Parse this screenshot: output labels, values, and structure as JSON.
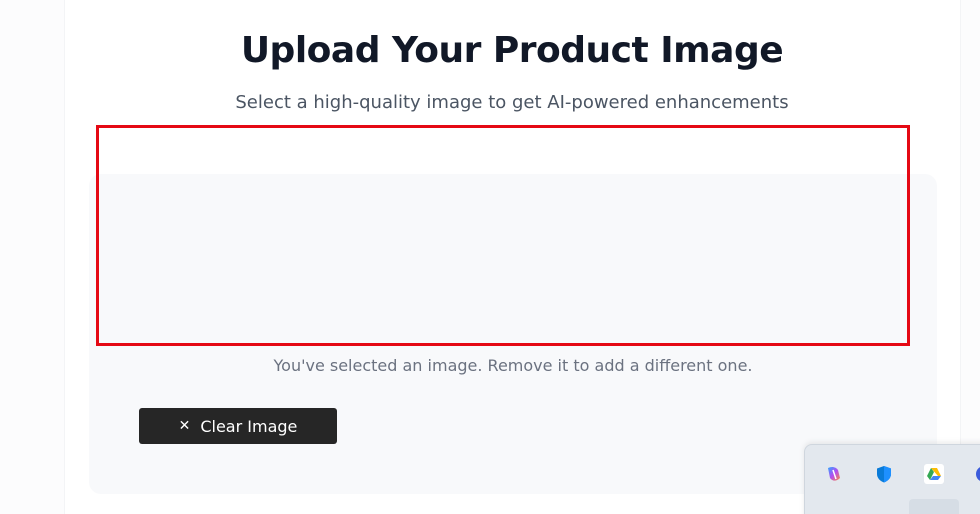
{
  "header": {
    "title": "Upload Your Product Image",
    "subtitle": "Select a high-quality image to get AI-powered enhancements"
  },
  "upload": {
    "help_text": "You've selected an image. Remove it to add a different one.",
    "clear_button": {
      "icon": "close-icon",
      "label": "Clear Image"
    }
  },
  "annotation": {
    "color": "#e50914"
  },
  "system_tray": {
    "icons": [
      "copilot-icon",
      "defender-shield-icon",
      "google-drive-icon",
      "partial-app-icon"
    ]
  },
  "colors": {
    "title": "#111827",
    "subtitle": "#4b5563",
    "card_bg": "#f8f9fb",
    "button_bg": "#262626",
    "button_text": "#ffffff"
  }
}
